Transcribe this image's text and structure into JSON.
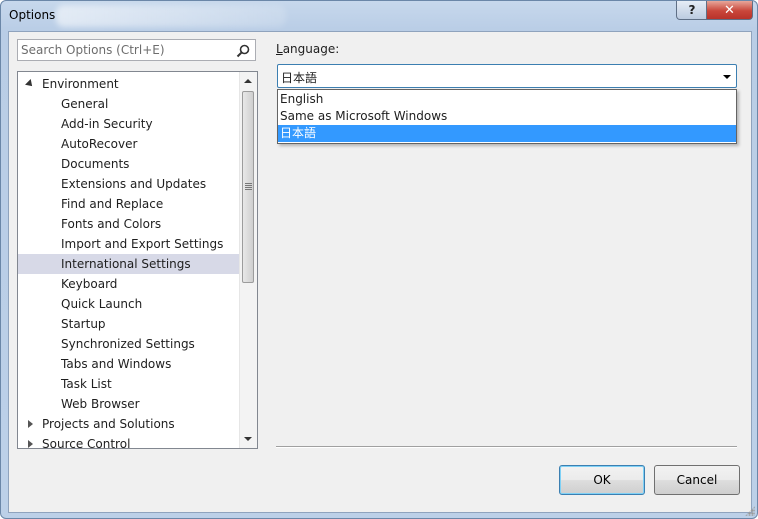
{
  "window": {
    "title": "Options",
    "help_label": "?",
    "close_label": "✕"
  },
  "search": {
    "placeholder": "Search Options (Ctrl+E)"
  },
  "tree": {
    "items": [
      {
        "label": "Environment",
        "level": 0,
        "expanded": true
      },
      {
        "label": "General",
        "level": 1
      },
      {
        "label": "Add-in Security",
        "level": 1
      },
      {
        "label": "AutoRecover",
        "level": 1
      },
      {
        "label": "Documents",
        "level": 1
      },
      {
        "label": "Extensions and Updates",
        "level": 1
      },
      {
        "label": "Find and Replace",
        "level": 1
      },
      {
        "label": "Fonts and Colors",
        "level": 1
      },
      {
        "label": "Import and Export Settings",
        "level": 1
      },
      {
        "label": "International Settings",
        "level": 1,
        "selected": true
      },
      {
        "label": "Keyboard",
        "level": 1
      },
      {
        "label": "Quick Launch",
        "level": 1
      },
      {
        "label": "Startup",
        "level": 1
      },
      {
        "label": "Synchronized Settings",
        "level": 1
      },
      {
        "label": "Tabs and Windows",
        "level": 1
      },
      {
        "label": "Task List",
        "level": 1
      },
      {
        "label": "Web Browser",
        "level": 1
      },
      {
        "label": "Projects and Solutions",
        "level": 0,
        "expanded": false
      },
      {
        "label": "Source Control",
        "level": 0,
        "expanded": false
      }
    ]
  },
  "language": {
    "label_accel": "L",
    "label_rest": "anguage:",
    "value": "日本語",
    "options": [
      "English",
      "Same as Microsoft Windows",
      "日本語"
    ],
    "selected_option": "日本語"
  },
  "buttons": {
    "ok": "OK",
    "cancel": "Cancel"
  },
  "colors": {
    "selection_highlight": "#3399ff",
    "tree_selection": "#d7d9e7",
    "frame": "#bcd0e8"
  }
}
